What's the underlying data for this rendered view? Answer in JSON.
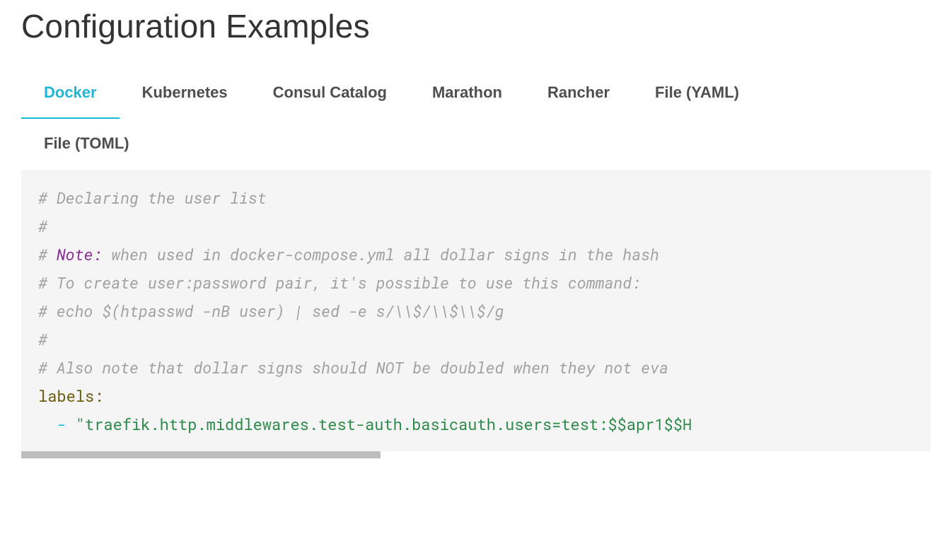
{
  "title": "Configuration Examples",
  "tabs": {
    "docker": {
      "label": "Docker",
      "active": true
    },
    "kubernetes": {
      "label": "Kubernetes",
      "active": false
    },
    "consul": {
      "label": "Consul Catalog",
      "active": false
    },
    "marathon": {
      "label": "Marathon",
      "active": false
    },
    "rancher": {
      "label": "Rancher",
      "active": false
    },
    "file_yaml": {
      "label": "File (YAML)",
      "active": false
    },
    "file_toml": {
      "label": "File (TOML)",
      "active": false
    }
  },
  "code": {
    "c1": "# Declaring the user list",
    "c2": "#",
    "c3a": "# ",
    "c3_note": "Note:",
    "c3b": " when used in docker-compose.yml all dollar signs in the hash ",
    "c4": "# To create user:password pair, it's possible to use this command:",
    "c5": "# echo $(htpasswd -nB user) | sed -e s/\\\\$/\\\\$\\\\$/g",
    "c6": "#",
    "c7": "# Also note that dollar signs should NOT be doubled when they not eva",
    "key_labels": "labels:",
    "dash": "-",
    "value": "\"traefik.http.middlewares.test-auth.basicauth.users=test:$$apr1$$H"
  }
}
